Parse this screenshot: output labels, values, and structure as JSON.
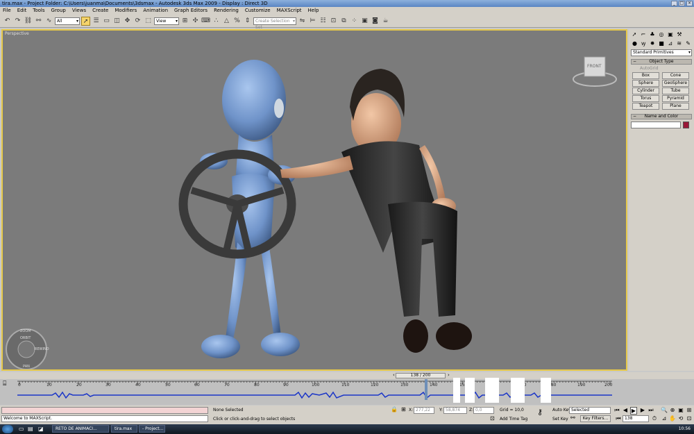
{
  "window": {
    "title": "tira.max    - Project Folder: C:\\Users\\juanma\\Documents\\3dsmax    - Autodesk 3ds Max  2009    - Display : Direct 3D"
  },
  "menu": [
    "File",
    "Edit",
    "Tools",
    "Group",
    "Views",
    "Create",
    "Modifiers",
    "Animation",
    "Graph Editors",
    "Rendering",
    "Customize",
    "MAXScript",
    "Help"
  ],
  "toolbar": {
    "filter_value": "All",
    "refcoord_value": "View",
    "selection_set_placeholder": "Create Selection Set"
  },
  "viewport": {
    "label": "Perspective",
    "viewcube_label": "FRONT",
    "nav_wheel": [
      "ZOOM",
      "ORBIT",
      "PAN",
      "REWIND"
    ]
  },
  "command_panel": {
    "category": "Standard Primitives",
    "object_type_title": "Object Type",
    "autogrid": "AutoGrid",
    "buttons": [
      "Box",
      "Cone",
      "Sphere",
      "GeoSphere",
      "Cylinder",
      "Tube",
      "Torus",
      "Pyramid",
      "Teapot",
      "Plane"
    ],
    "name_color_title": "Name and Color",
    "object_color": "#9a1838"
  },
  "timeslider": {
    "position": "138 / 200",
    "frame": 138,
    "total": 200
  },
  "track_ruler": {
    "ticks": [
      "0",
      "10",
      "20",
      "30",
      "40",
      "50",
      "60",
      "70",
      "80",
      "90",
      "100",
      "110",
      "120",
      "130",
      "140",
      "150",
      "160",
      "170",
      "180",
      "190",
      "200"
    ]
  },
  "status": {
    "maxscript": "Welcome to MAXScript.",
    "selection": "None Selected",
    "prompt": "Click or click-and-drag to select objects",
    "x_label": "X:",
    "x_value": "277,22",
    "y_label": "Y:",
    "y_value": "58,874",
    "z_label": "Z:",
    "z_value": "0,0",
    "grid": "Grid = 10,0",
    "add_time_tag": "Add Time Tag",
    "auto_key": "Auto Key",
    "set_key": "Set Key",
    "key_mode": "Selected",
    "key_filters": "Key Filters...",
    "current_frame": "138"
  },
  "taskbar": {
    "tasks": [
      "RETO DE ANIMACI...",
      "tira.max",
      "- Project..."
    ],
    "clock": "10:56"
  }
}
